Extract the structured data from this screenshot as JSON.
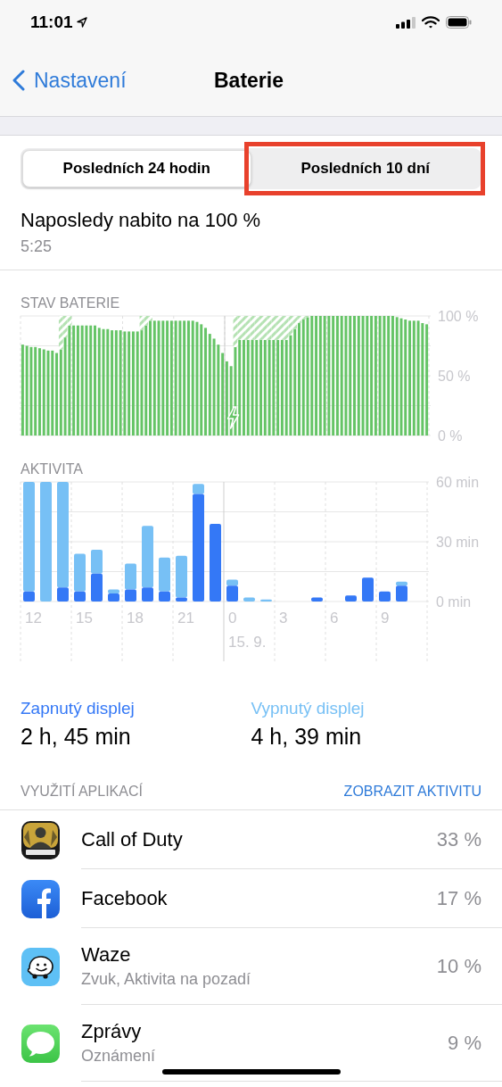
{
  "status_bar": {
    "time": "11:01"
  },
  "nav": {
    "back": "Nastavení",
    "title": "Baterie"
  },
  "segments": [
    {
      "label": "Posledních 24 hodin",
      "selected": true,
      "highlighted": false
    },
    {
      "label": "Posledních 10 dní",
      "selected": false,
      "highlighted": true
    }
  ],
  "last_charged": {
    "title": "Naposledy nabito na 100 %",
    "time": "5:25"
  },
  "battery": {
    "label": "STAV BATERIE",
    "chart_data": {
      "type": "bar",
      "stacked": true,
      "ylim": [
        0,
        100
      ],
      "yticks": [
        {
          "value": 0,
          "label": "0 %"
        },
        {
          "value": 50,
          "label": "50 %"
        },
        {
          "value": 100,
          "label": "100 %"
        }
      ],
      "series": [
        {
          "color": "#65c466",
          "values": [
            76,
            75,
            74,
            74,
            73,
            72,
            71,
            71,
            69,
            72,
            82,
            92,
            92,
            92,
            92,
            92,
            92,
            92,
            90,
            89,
            89,
            88,
            88,
            88,
            87,
            87,
            87,
            87,
            88,
            92,
            96,
            96,
            96,
            96,
            96,
            96,
            96,
            96,
            96,
            96,
            96,
            95,
            93,
            90,
            85,
            81,
            76,
            69,
            62,
            58,
            74,
            80,
            80,
            80,
            80,
            80,
            80,
            80,
            80,
            80,
            80,
            80,
            80,
            84,
            89,
            94,
            97,
            99,
            100,
            100,
            100,
            100,
            100,
            100,
            100,
            100,
            100,
            100,
            100,
            100,
            100,
            100,
            100,
            100,
            100,
            100,
            100,
            100,
            99,
            98,
            97,
            96,
            96,
            96,
            94,
            93
          ]
        },
        {
          "color": "#b5e2b3",
          "values": [
            null,
            null,
            null,
            null,
            null,
            null,
            null,
            null,
            null,
            28,
            18,
            8,
            null,
            null,
            null,
            null,
            null,
            null,
            null,
            null,
            null,
            null,
            null,
            null,
            null,
            null,
            null,
            null,
            12,
            8,
            4,
            null,
            null,
            null,
            null,
            null,
            null,
            null,
            null,
            null,
            null,
            null,
            null,
            null,
            null,
            null,
            null,
            null,
            null,
            null,
            26,
            20,
            20,
            20,
            20,
            20,
            20,
            20,
            20,
            20,
            20,
            20,
            20,
            16,
            11,
            6,
            3,
            1,
            null,
            null,
            null,
            null,
            null,
            null,
            null,
            null,
            null,
            null,
            null,
            null,
            null,
            null,
            null,
            null,
            null,
            null,
            null,
            null,
            null,
            null,
            null,
            null,
            null,
            null,
            null,
            null
          ]
        }
      ]
    }
  },
  "activity": {
    "label": "AKTIVITA",
    "chart_data": {
      "type": "bar",
      "stacked": true,
      "ylim": [
        0,
        60
      ],
      "yticks": [
        {
          "value": 0,
          "label": "0 min"
        },
        {
          "value": 30,
          "label": "30 min"
        },
        {
          "value": 60,
          "label": "60 min"
        }
      ],
      "categories": [
        "12",
        null,
        null,
        "15",
        null,
        null,
        "18",
        null,
        null,
        "21",
        null,
        null,
        "0",
        null,
        null,
        "3",
        null,
        null,
        "6",
        null,
        null,
        "9",
        null,
        null
      ],
      "series": [
        {
          "name": "Zapnutý displej",
          "color": "#3478f6",
          "values": [
            5,
            0,
            7,
            5,
            14,
            4,
            6,
            7,
            5,
            2,
            54,
            39,
            8,
            0,
            0,
            0,
            0,
            2,
            0,
            3,
            12,
            5,
            8,
            null
          ]
        },
        {
          "name": "Vypnutý displej",
          "color": "#77c0f5",
          "values": [
            55,
            60,
            53,
            19,
            12,
            2,
            13,
            31,
            17,
            21,
            5,
            0,
            3,
            2,
            1,
            0,
            0,
            0,
            0,
            0,
            0,
            0,
            2,
            null
          ]
        }
      ]
    },
    "date_label": "15. 9."
  },
  "screen": [
    {
      "value": "2 h, 45 min"
    },
    {
      "value": "4 h, 39 min"
    }
  ],
  "app_usage": {
    "label": "VYUŽITÍ APLIKACÍ",
    "action": "ZOBRAZIT AKTIVITU"
  },
  "apps": [
    {
      "kind": "game",
      "name": "Call of Duty",
      "percent": "33 %"
    },
    {
      "kind": "facebook",
      "name": "Facebook",
      "percent": "17 %"
    },
    {
      "kind": "waze",
      "name": "Waze",
      "detail": "Zvuk, Aktivita na pozadí",
      "percent": "10 %"
    },
    {
      "kind": "messages",
      "name": "Zprávy",
      "detail": "Oznámení",
      "percent": "9 %"
    }
  ]
}
